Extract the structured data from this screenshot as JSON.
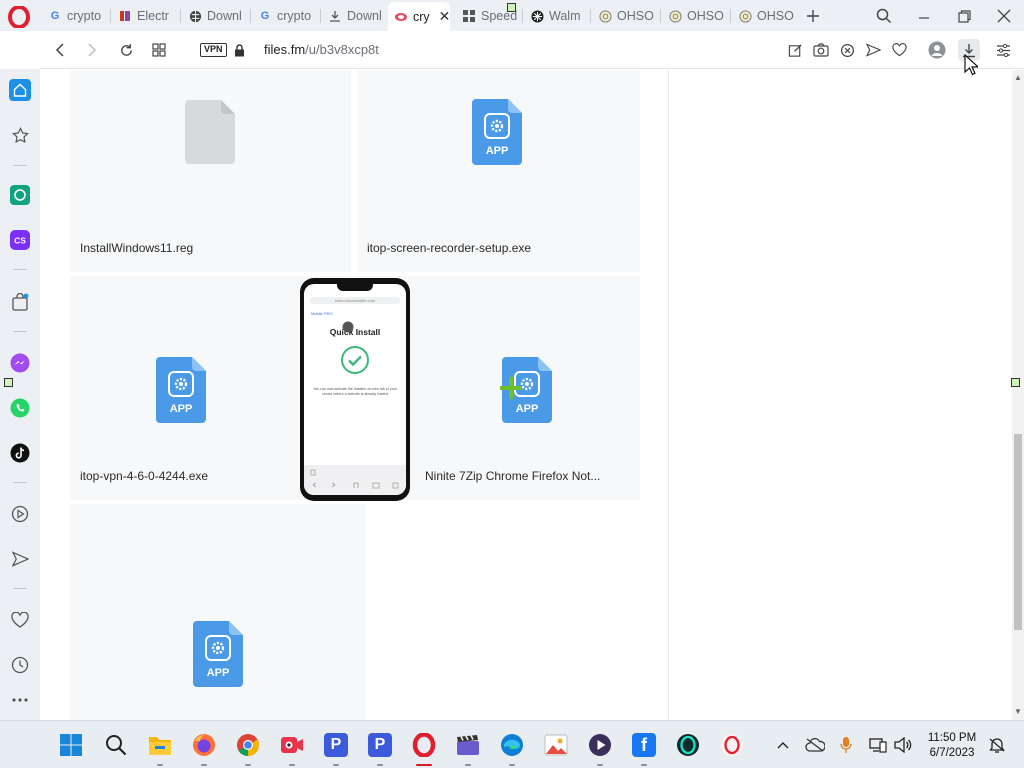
{
  "browser": {
    "tabs": [
      {
        "label": "crypto",
        "favicon": "google-g-icon",
        "active": false
      },
      {
        "label": "Electr",
        "favicon": "page-icon",
        "active": false
      },
      {
        "label": "Downl",
        "favicon": "globe-icon",
        "active": false
      },
      {
        "label": "crypto",
        "favicon": "google-g-icon",
        "active": false
      },
      {
        "label": "Downl",
        "favicon": "download-icon",
        "active": false
      },
      {
        "label": "cry",
        "favicon": "files-fm-icon",
        "active": true
      },
      {
        "label": "Speed",
        "favicon": "grid-icon",
        "active": false
      },
      {
        "label": "Walm",
        "favicon": "walmart-icon",
        "active": false
      },
      {
        "label": "OHSO",
        "favicon": "ohso-icon",
        "active": false
      },
      {
        "label": "OHSO",
        "favicon": "ohso-icon",
        "active": false
      },
      {
        "label": "OHSO",
        "favicon": "ohso-icon",
        "active": false
      }
    ],
    "address": {
      "vpn_label": "VPN",
      "url_host": "files.fm",
      "url_path": "/u/b3v8xcp8t"
    }
  },
  "files": [
    {
      "name": "InstallWindows11.reg",
      "icon": "generic-file-icon"
    },
    {
      "name": "itop-screen-recorder-setup.exe",
      "icon": "app-file-icon",
      "icon_label": "APP"
    },
    {
      "name": "itop-vpn-4-6-0-4244.exe",
      "icon": "app-file-icon",
      "icon_label": "APP"
    },
    {
      "name": "Ninite 7Zip Chrome Firefox Not...",
      "icon": "app-file-icon",
      "icon_label": "APP"
    },
    {
      "name": "",
      "icon": "app-file-icon",
      "icon_label": "APP"
    }
  ],
  "phone_overlay": {
    "title": "Quick Install",
    "brand": "Mobile PRO",
    "url": "www.ohsoinstaller.com",
    "body": "You can now activate the installer on new tab of your choice before a website is already loaded"
  },
  "taskbar": {
    "time": "11:50 PM",
    "date": "6/7/2023"
  },
  "colors": {
    "opera_red": "#d81b2a",
    "app_icon_blue": "#4a9ae8",
    "sidebar_bg": "#eceff3"
  }
}
